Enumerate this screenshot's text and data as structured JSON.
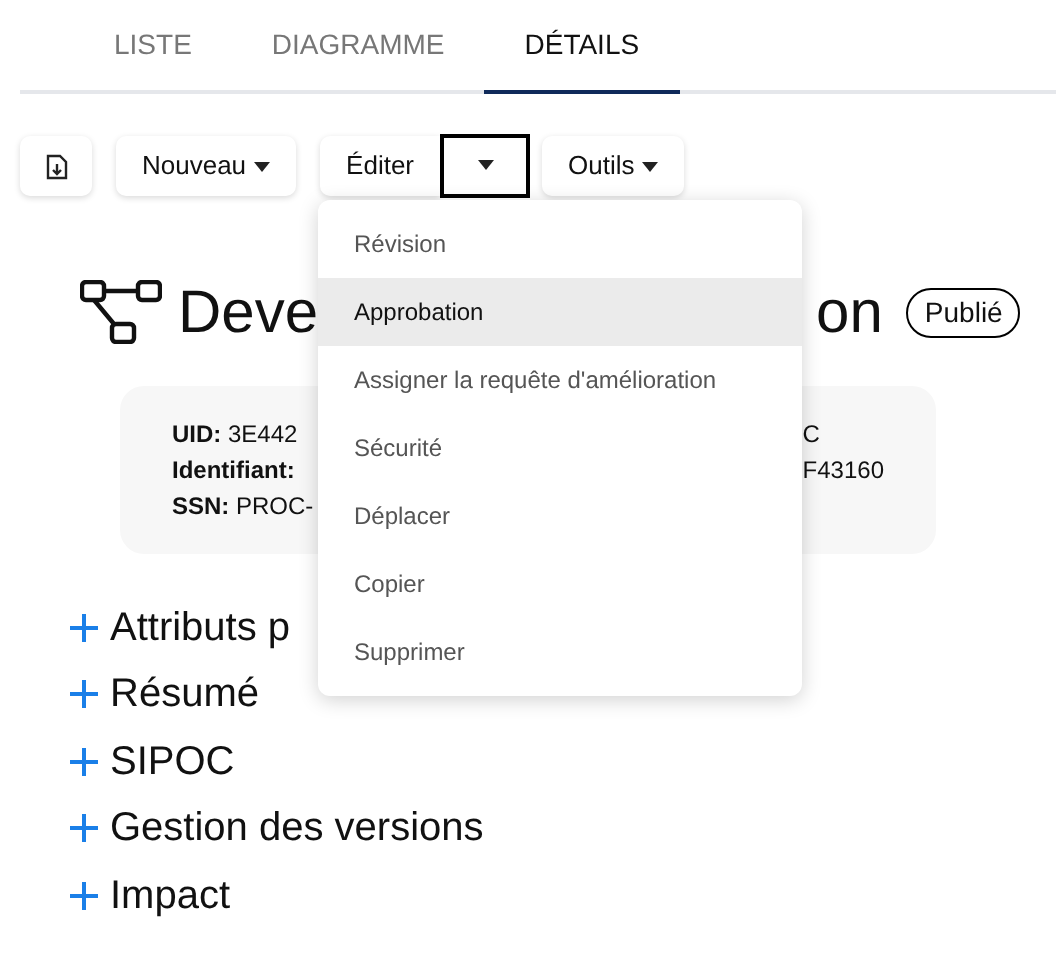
{
  "tabs": [
    {
      "label": "LISTE",
      "selected": false
    },
    {
      "label": "DIAGRAMME",
      "selected": false
    },
    {
      "label": "DÉTAILS",
      "selected": true
    }
  ],
  "toolbar": {
    "new_button": "Nouveau",
    "edit_button": "Éditer",
    "tools_button": "Outils"
  },
  "menu": [
    {
      "label": "Révision",
      "selected": false
    },
    {
      "label": "Approbation",
      "selected": true
    },
    {
      "label": "Assigner la requête d'amélioration",
      "selected": false
    },
    {
      "label": "Sécurité",
      "selected": false
    },
    {
      "label": "Déplacer",
      "selected": false
    },
    {
      "label": "Copier",
      "selected": false
    },
    {
      "label": "Supprimer",
      "selected": false
    }
  ],
  "title": {
    "start": "Deve",
    "end": "on",
    "status": "Publié"
  },
  "info": {
    "left": [
      {
        "label": "UID:",
        "value": "3E442"
      },
      {
        "label": "Identifiant:"
      },
      {
        "label": "SSN:",
        "value": "PROC-"
      }
    ],
    "right": [
      "C",
      "F43160"
    ]
  },
  "sections": [
    "Attributs p",
    "Résumé",
    "SIPOC",
    "Gestion des versions",
    "Impact"
  ]
}
